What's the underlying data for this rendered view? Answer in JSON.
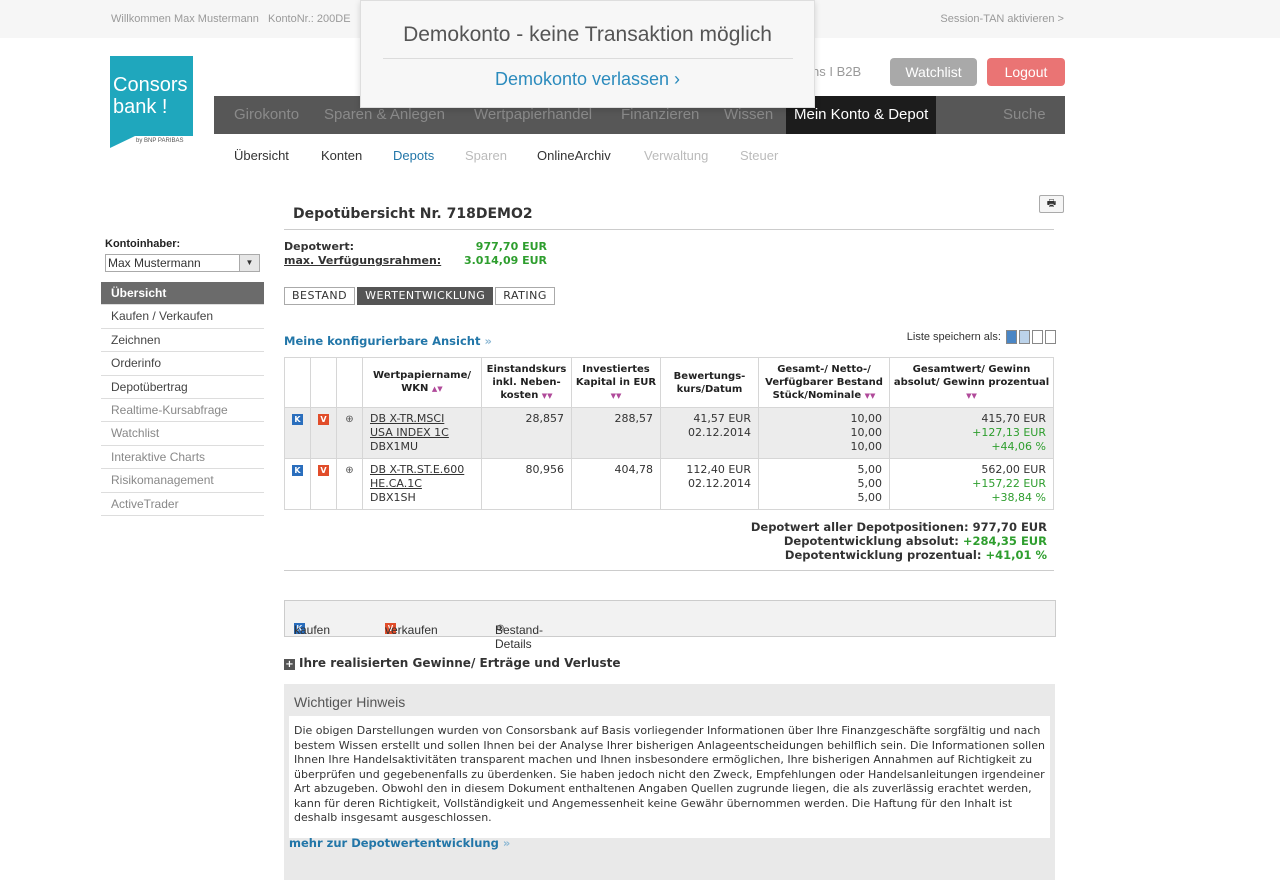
{
  "topbar": {
    "welcome": "Willkommen Max Mustermann",
    "konto": "KontoNr.: 200DE",
    "session": "Session-TAN aktivieren >"
  },
  "logo": {
    "line1": "Consors",
    "line2": "bank !",
    "sub": "by BNP PARIBAS"
  },
  "header": {
    "links": "ns  I  B2B",
    "watchlist": "Watchlist",
    "logout": "Logout"
  },
  "modal": {
    "message": "Demokonto - keine Transaktion möglich",
    "leave": "Demokonto verlassen ›"
  },
  "mainnav": [
    "Girokonto",
    "Sparen & Anlegen",
    "Wertpapierhandel",
    "Finanzieren",
    "Wissen",
    "Mein Konto & Depot",
    "Suche"
  ],
  "subnav": [
    "Übersicht",
    "Konten",
    "Depots",
    "Sparen",
    "OnlineArchiv",
    "Verwaltung",
    "Steuer"
  ],
  "sidebar": {
    "owner_label": "Kontoinhaber:",
    "owner_value": "Max Mustermann",
    "items": [
      "Übersicht",
      "Kaufen / Verkaufen",
      "Zeichnen",
      "Orderinfo",
      "Depotübertrag",
      "Realtime-Kursabfrage",
      "Watchlist",
      "Interaktive Charts",
      "Risikomanagement",
      "ActiveTrader"
    ]
  },
  "depot": {
    "title": "Depotübersicht Nr. 718DEMO2",
    "depotwert_label": "Depotwert:",
    "depotwert_value": "977,70 EUR",
    "rahmen_label": "max. Verfügungsrahmen:",
    "rahmen_value": "3.014,09 EUR",
    "tabs": [
      "BESTAND",
      "WERTENTWICKLUNG",
      "RATING"
    ],
    "config_link": "Meine konfigurierbare Ansicht",
    "liste_label": "Liste speichern als:"
  },
  "table": {
    "headers": [
      "Wertpapiername/ WKN",
      "Einstandskurs inkl. Neben- kosten",
      "Investiertes Kapital in EUR",
      "Bewertungs- kurs/Datum",
      "Gesamt-/ Netto-/ Verfügbarer Bestand Stück/Nominale",
      "Gesamtwert/ Gewinn absolut/ Gewinn prozentual"
    ],
    "rows": [
      {
        "name1": "DB X-TR.MSCI",
        "name2": "USA INDEX 1C",
        "wkn": "DBX1MU",
        "einstand": "28,857",
        "kapital": "288,57",
        "kurs": "41,57 EUR",
        "datum": "02.12.2014",
        "b1": "10,00",
        "b2": "10,00",
        "b3": "10,00",
        "gw": "415,70 EUR",
        "gabs": "+127,13 EUR",
        "gpct": "+44,06 %"
      },
      {
        "name1": "DB X-TR.ST.E.600",
        "name2": "HE.CA.1C",
        "wkn": "DBX1SH",
        "einstand": "80,956",
        "kapital": "404,78",
        "kurs": "112,40 EUR",
        "datum": "02.12.2014",
        "b1": "5,00",
        "b2": "5,00",
        "b3": "5,00",
        "gw": "562,00 EUR",
        "gabs": "+157,22 EUR",
        "gpct": "+38,84 %"
      }
    ]
  },
  "totals": {
    "l1": "Depotwert aller Depotpositionen:",
    "v1": "977,70 EUR",
    "l2": "Depotentwicklung absolut:",
    "v2": "+284,35 EUR",
    "l3": "Depotentwicklung prozentual:",
    "v3": "+41,01 %"
  },
  "legend": {
    "kaufen": "kaufen",
    "verkaufen": "verkaufen",
    "details": "Bestand-Details"
  },
  "realised": "Ihre realisierten Gewinne/ Erträge und Verluste",
  "notice": {
    "title": "Wichtiger Hinweis",
    "body": "Die obigen Darstellungen wurden von Consorsbank auf Basis vorliegender Informationen über Ihre Finanzgeschäfte sorgfältig und nach bestem Wissen erstellt und sollen Ihnen bei der Analyse Ihrer bisherigen Anlageentscheidungen behilflich sein. Die Informationen sollen Ihnen Ihre Handelsaktivitäten transparent machen und Ihnen insbesondere ermöglichen, Ihre bisherigen Annahmen auf Richtigkeit zu überprüfen und gegebenenfalls zu überdenken. Sie haben jedoch nicht den Zweck, Empfehlungen oder Handelsanleitungen irgendeiner Art abzugeben. Obwohl den in diesem Dokument enthaltenen Angaben Quellen zugrunde liegen, die als zuverlässig erachtet werden, kann für deren Richtigkeit, Vollständigkeit und Angemessenheit keine Gewähr übernommen werden. Die Haftung für den Inhalt ist deshalb insgesamt ausgeschlossen.",
    "more": "mehr zur Depotwertentwicklung"
  }
}
